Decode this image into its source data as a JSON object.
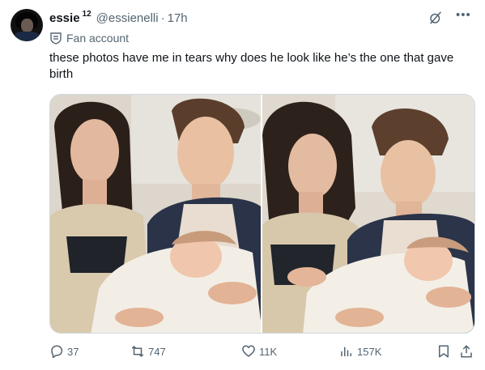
{
  "tweet": {
    "author_name": "essie",
    "author_badge": "12",
    "handle": "@essienelli",
    "separator": "·",
    "time": "17h",
    "community_label": "Fan account",
    "text": "these photos have me in tears why does he look like he’s the one that gave birth"
  },
  "actions": {
    "replies": "37",
    "reposts": "747",
    "likes": "11K",
    "views": "157K"
  },
  "icons": [
    "avatar",
    "grok-icon",
    "more-icon",
    "community-icon",
    "reply-icon",
    "repost-icon",
    "like-icon",
    "views-icon",
    "bookmark-icon",
    "share-icon"
  ],
  "colors": {
    "text_primary": "#0f1419",
    "text_secondary": "#536471",
    "border": "#cfd9de"
  }
}
